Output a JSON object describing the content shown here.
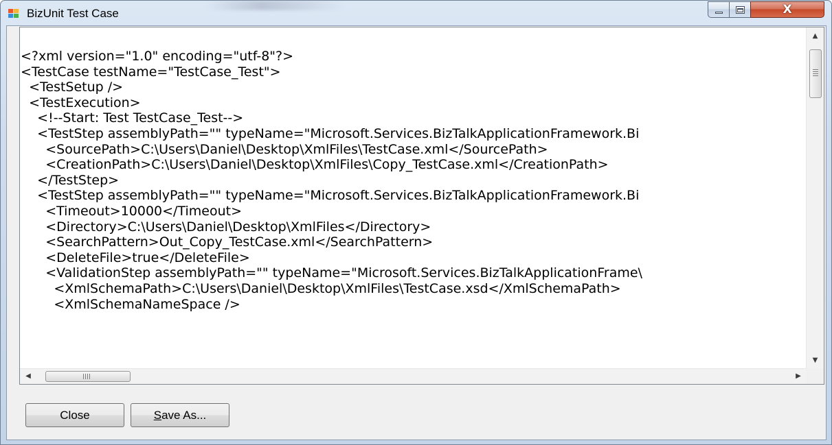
{
  "window": {
    "title": "BizUnit Test Case",
    "close_glyph": "X"
  },
  "editor": {
    "lines": [
      "<?xml version=\"1.0\" encoding=\"utf-8\"?>",
      "<TestCase testName=\"TestCase_Test\">",
      "  <TestSetup />",
      "  <TestExecution>",
      "    <!--Start: Test TestCase_Test-->",
      "    <TestStep assemblyPath=\"\" typeName=\"Microsoft.Services.BizTalkApplicationFramework.Bi",
      "      <SourcePath>C:\\Users\\Daniel\\Desktop\\XmlFiles\\TestCase.xml</SourcePath>",
      "      <CreationPath>C:\\Users\\Daniel\\Desktop\\XmlFiles\\Copy_TestCase.xml</CreationPath>",
      "    </TestStep>",
      "    <TestStep assemblyPath=\"\" typeName=\"Microsoft.Services.BizTalkApplicationFramework.Bi",
      "      <Timeout>10000</Timeout>",
      "      <Directory>C:\\Users\\Daniel\\Desktop\\XmlFiles</Directory>",
      "      <SearchPattern>Out_Copy_TestCase.xml</SearchPattern>",
      "      <DeleteFile>true</DeleteFile>",
      "      <ValidationStep assemblyPath=\"\" typeName=\"Microsoft.Services.BizTalkApplicationFrame\\",
      "        <XmlSchemaPath>C:\\Users\\Daniel\\Desktop\\XmlFiles\\TestCase.xsd</XmlSchemaPath>",
      "        <XmlSchemaNameSpace />"
    ]
  },
  "buttons": {
    "close_label": "Close",
    "save_as_mnemonic": "S",
    "save_as_rest": "ave As..."
  },
  "colors": {
    "close_button_red": "#c74a2b",
    "frame_blue": "#c3d4e9"
  }
}
